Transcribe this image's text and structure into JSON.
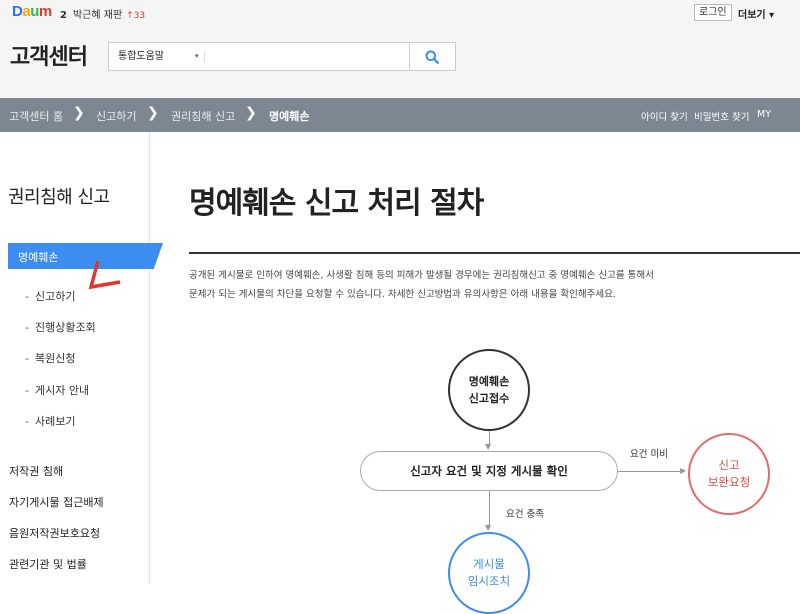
{
  "topbar": {
    "logo": {
      "d": "D",
      "a": "a",
      "u": "u",
      "m": "m"
    },
    "trend": {
      "rank": "2",
      "keyword": "박근혜 재판",
      "change": "↑33"
    },
    "login_label": "로그인",
    "more_label": "더보기 ▾"
  },
  "header": {
    "title": "고객센터",
    "search": {
      "select_value": "통합도움말",
      "caret": "▾",
      "value": ""
    }
  },
  "breadcrumb": {
    "items": [
      "고객센터 홈",
      "신고하기",
      "권리침해 신고",
      "명예훼손"
    ],
    "separator": "❯"
  },
  "util_links": [
    "아이디 찾기",
    "비밀번호 찾기",
    "MY"
  ],
  "sidebar": {
    "title": "권리침해 신고",
    "active": "명예훼손",
    "sub_items": [
      "신고하기",
      "진행상황조회",
      "복원신청",
      "게시자 안내",
      "사례보기"
    ],
    "main_items": [
      "저작권 침해",
      "자기게시물 접근배제",
      "음원저작권보호요청",
      "관련기관 및 법률"
    ]
  },
  "main": {
    "title": "명예훼손 신고 처리 절차",
    "desc_line1": "공개된 게시물로 인하여 명예훼손, 사생활 침해 등의 피해가 발생될 경우에는 권리침해신고 중 명예훼손 신고를 통해서",
    "desc_line2": "문제가 되는 게시물의 차단을 요청할 수 있습니다. 자세한 신고방법과 유의사항은 아래 내용을 확인해주세요."
  },
  "flow": {
    "step1_line1": "명예훼손",
    "step1_line2": "신고접수",
    "confirm": "신고자 요건 및 지정 게시물 확인",
    "edge_incomplete": "요건 미비",
    "edge_satisfied": "요건 충족",
    "supplement_line1": "신고",
    "supplement_line2": "보완요청",
    "temp_line1": "게시물",
    "temp_line2": "임시조치"
  },
  "colors": {
    "accent_blue": "#3d8cf0",
    "alert_red": "#d94b4b",
    "crumb_bg": "#7d8791"
  }
}
